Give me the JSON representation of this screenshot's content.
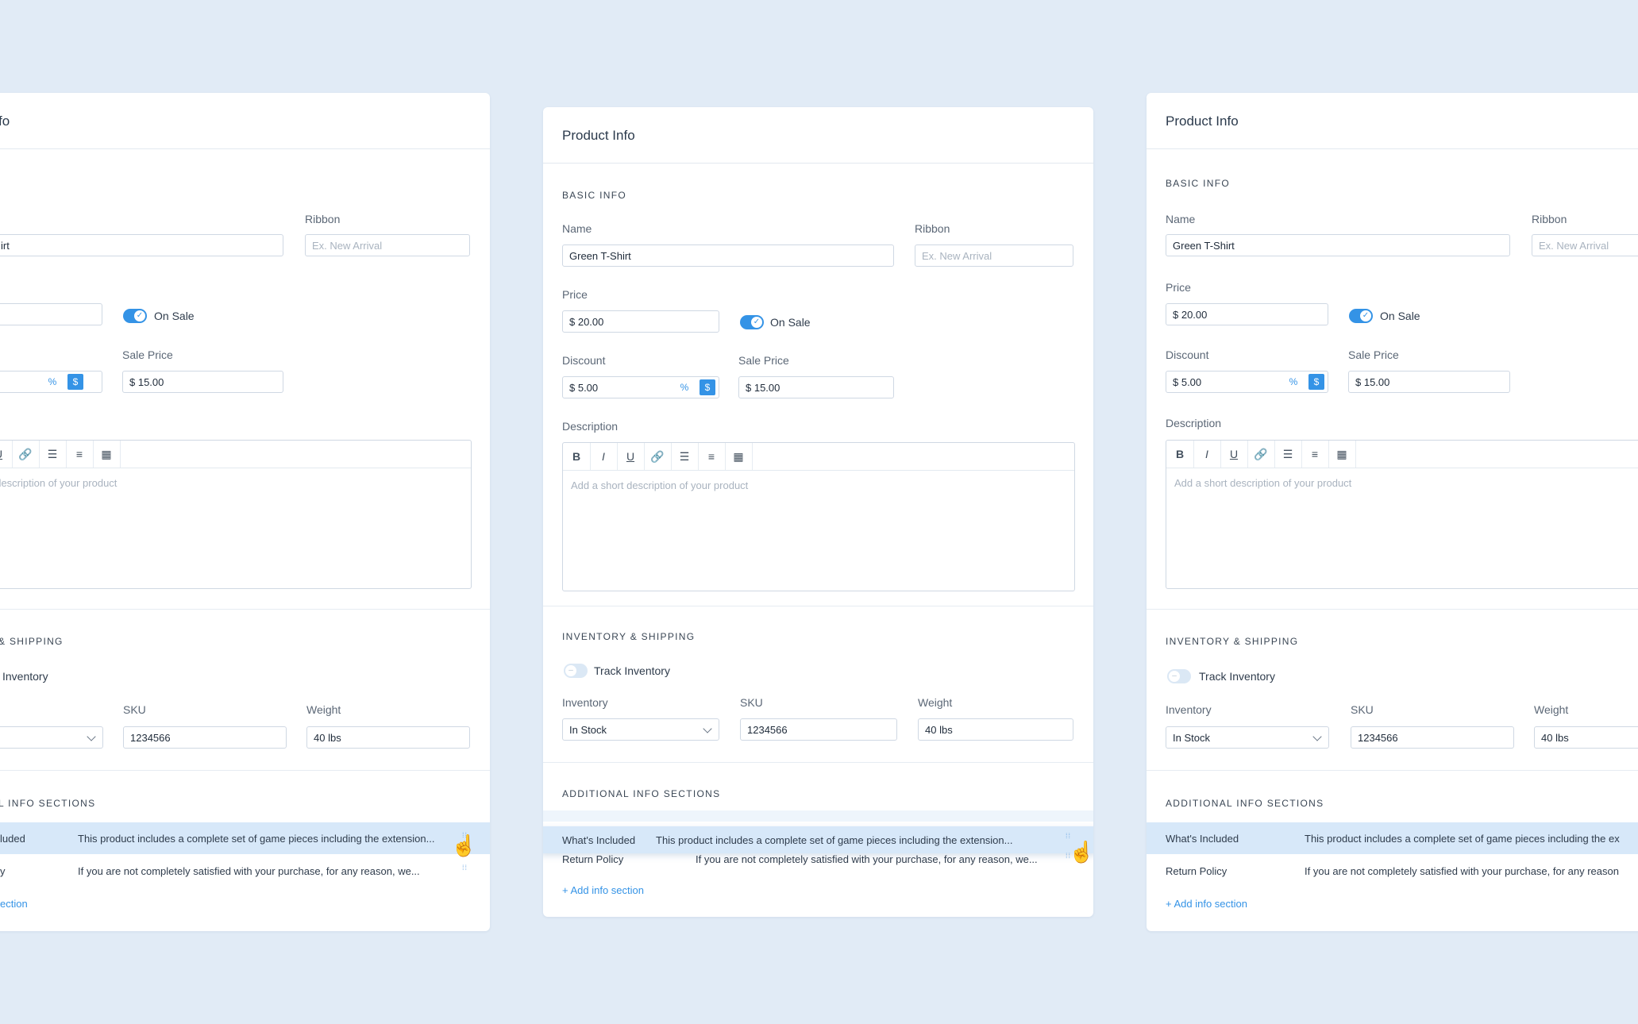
{
  "card": {
    "title": "Product Info",
    "title_clipped_left": "fo",
    "basic_info": {
      "section_title": "BASIC INFO",
      "name_label": "Name",
      "name_value": "Green T-Shirt",
      "name_value_clipped": "irt",
      "ribbon_label": "Ribbon",
      "ribbon_placeholder": "Ex. New Arrival",
      "price_label": "Price",
      "price_value": "$ 20.00",
      "on_sale_label": "On Sale",
      "discount_label": "Discount",
      "discount_value": "$ 5.00",
      "unit_percent": "%",
      "unit_dollar": "$",
      "sale_price_label": "Sale Price",
      "sale_price_value": "$ 15.00",
      "description_label": "Description",
      "description_placeholder": "Add a short description of your product",
      "description_placeholder_clipped": "t description of your product",
      "toolbar": {
        "bold": "B",
        "italic": "I",
        "underline": "U"
      }
    },
    "inventory": {
      "section_title": "INVENTORY & SHIPPING",
      "section_title_clipped": "& SHIPPING",
      "track_label": "Track Inventory",
      "track_label_clipped": "Inventory",
      "inventory_label": "Inventory",
      "inventory_value": "In Stock",
      "sku_label": "SKU",
      "sku_value": "1234566",
      "weight_label": "Weight",
      "weight_value": "40 lbs"
    },
    "additional": {
      "section_title": "ADDITIONAL INFO SECTIONS",
      "section_title_clipped": "L INFO SECTIONS",
      "rows": [
        {
          "name": "What's Included",
          "name_clipped": "luded",
          "desc": "This product includes a complete set of game pieces including the extension...",
          "desc_clipped_right": "This product includes a complete set of game pieces including the ex"
        },
        {
          "name": "Return Policy",
          "name_clipped": "y",
          "desc": "If you are not completely satisfied with your purchase, for any reason, we...",
          "desc_clipped_right": "If you are not completely satisfied with your purchase, for any reason"
        }
      ],
      "add_link": "+ Add info section",
      "add_link_clipped": "ection"
    }
  },
  "icons": {
    "link": "link-icon",
    "bullet_list": "bullet-list-icon",
    "numbered_list": "numbered-list-icon",
    "table": "table-icon",
    "drag": "drag-handle-icon",
    "cursor": "hand-pointer-icon"
  },
  "colors": {
    "background": "#e1ebf6",
    "accent": "#3493e6",
    "row_highlight": "#d7e8f9"
  }
}
